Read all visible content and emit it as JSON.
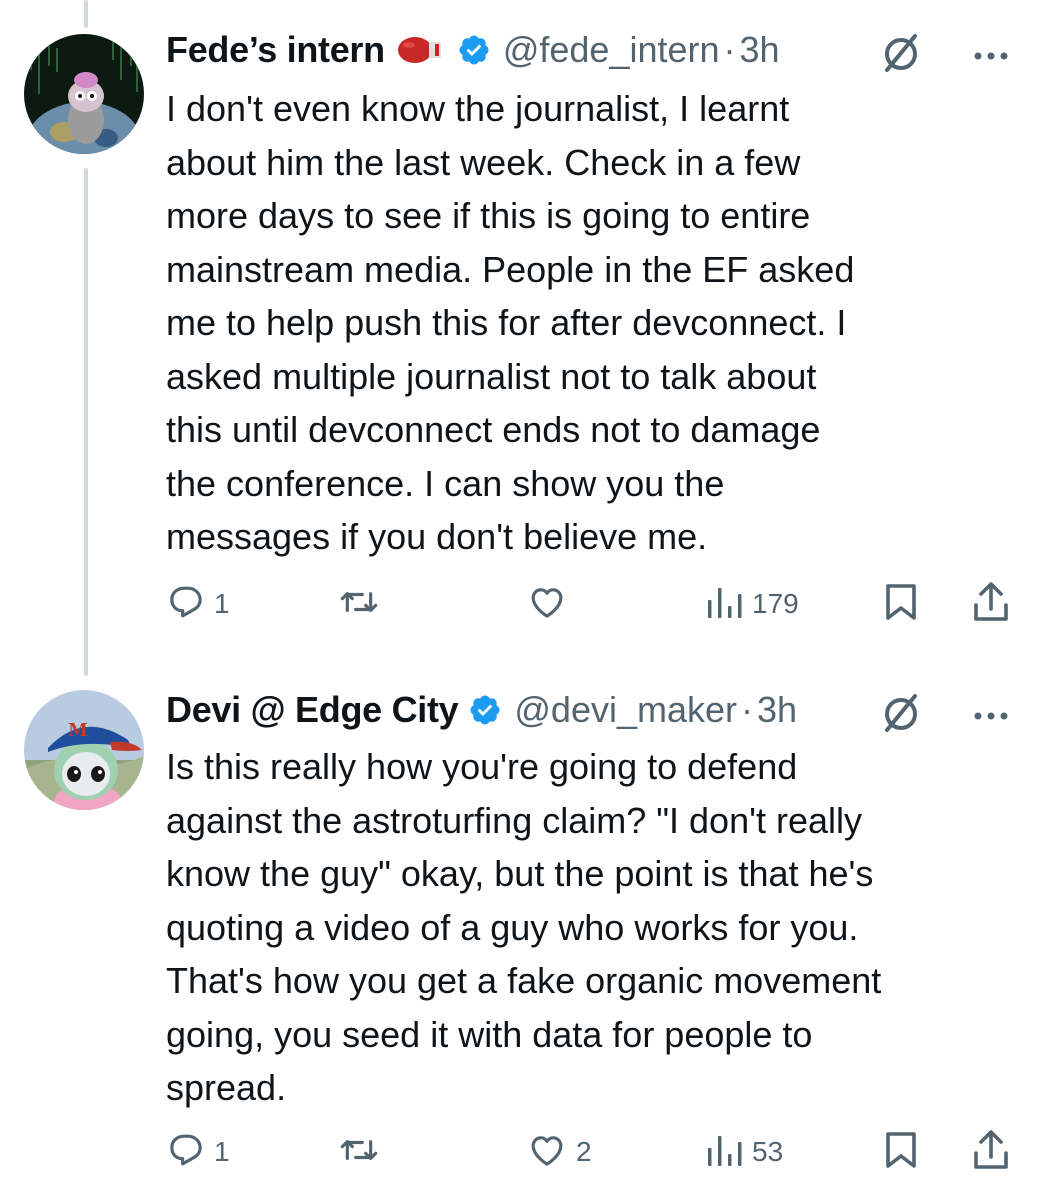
{
  "tweets": [
    {
      "display_name": "Fede’s intern",
      "handle": "@fede_intern",
      "separator": "·",
      "time": "3h",
      "text": "I don't even know the journalist, I learnt\nabout him the last week. Check in a few\nmore days to see if this is going to entire\nmainstream media. People in the EF asked\nme to help push this for after devconnect. I\nasked multiple journalist not to talk about\nthis until devconnect ends not to damage\nthe conference. I can show you the\nmessages if you don't believe me.",
      "reply_count": "1",
      "retweet_count": "",
      "like_count": "",
      "view_count": "179"
    },
    {
      "display_name": "Devi @ Edge City",
      "handle": "@devi_maker",
      "separator": "·",
      "time": "3h",
      "text": "Is this really how you're going to defend\nagainst the astroturfing claim? \"I don't really\nknow the guy\" okay, but the point is that he's\nquoting a video of a guy who works for you.\nThat's how you get a fake organic movement\ngoing, you seed it with data for people to\nspread.",
      "reply_count": "1",
      "retweet_count": "",
      "like_count": "2",
      "view_count": "53"
    }
  ],
  "icons": {
    "emoji": "boxing-glove-icon",
    "verified": "verified-badge-icon",
    "grok": "grok-icon",
    "more": "more-icon",
    "reply": "reply-icon",
    "retweet": "retweet-icon",
    "like": "like-icon",
    "views": "views-icon",
    "bookmark": "bookmark-icon",
    "share": "share-icon"
  },
  "colors": {
    "text": "#0f1419",
    "secondary": "#536471",
    "verified": "#1d9bf0",
    "thread_line": "#cfd9de"
  }
}
